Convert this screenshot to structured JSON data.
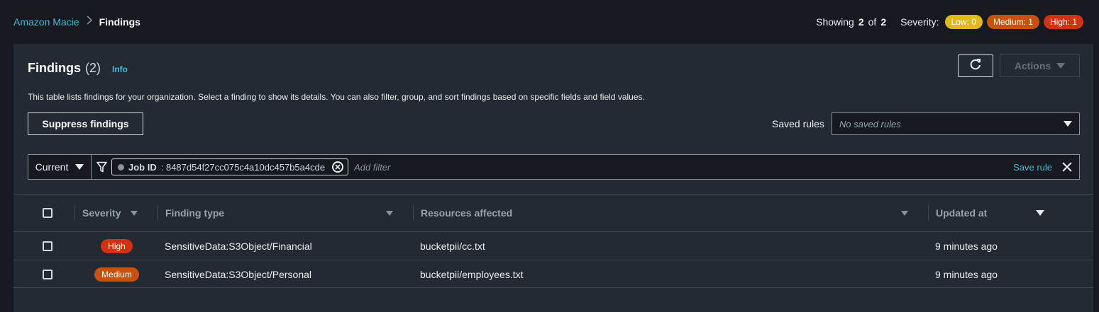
{
  "breadcrumb": {
    "root": "Amazon Macie",
    "current": "Findings"
  },
  "summary": {
    "showing_label": "Showing",
    "shown": "2",
    "of_label": "of",
    "total": "2",
    "severity_label": "Severity:",
    "low": "Low: 0",
    "medium": "Medium: 1",
    "high": "High: 1"
  },
  "panel": {
    "title": "Findings",
    "count": "(2)",
    "info": "Info",
    "description": "This table lists findings for your organization. Select a finding to show its details. You can also filter, group, and sort findings based on specific fields and field values.",
    "actions_label": "Actions",
    "suppress_label": "Suppress findings",
    "saved_rules_label": "Saved rules",
    "saved_rules_value": "No saved rules"
  },
  "filter": {
    "current_label": "Current",
    "token_key": "Job ID",
    "token_value": ": 8487d54f27cc075c4a10dc457b5a4cde",
    "placeholder": "Add filter",
    "save_rule": "Save rule"
  },
  "table": {
    "columns": {
      "severity": "Severity",
      "finding_type": "Finding type",
      "resources": "Resources affected",
      "updated": "Updated at"
    },
    "rows": [
      {
        "severity": "High",
        "finding_type": "SensitiveData:S3Object/Financial",
        "resource": "bucketpii/cc.txt",
        "updated": "9 minutes ago"
      },
      {
        "severity": "Medium",
        "finding_type": "SensitiveData:S3Object/Personal",
        "resource": "bucketpii/employees.txt",
        "updated": "9 minutes ago"
      }
    ]
  },
  "icons": {
    "chevron": "chevron-right-icon",
    "refresh": "refresh-icon",
    "filter": "funnel-icon",
    "close": "close-icon"
  },
  "colors": {
    "accent": "#44b9d6",
    "high": "#d13212",
    "medium": "#c7510e",
    "low": "#e3b81a"
  }
}
